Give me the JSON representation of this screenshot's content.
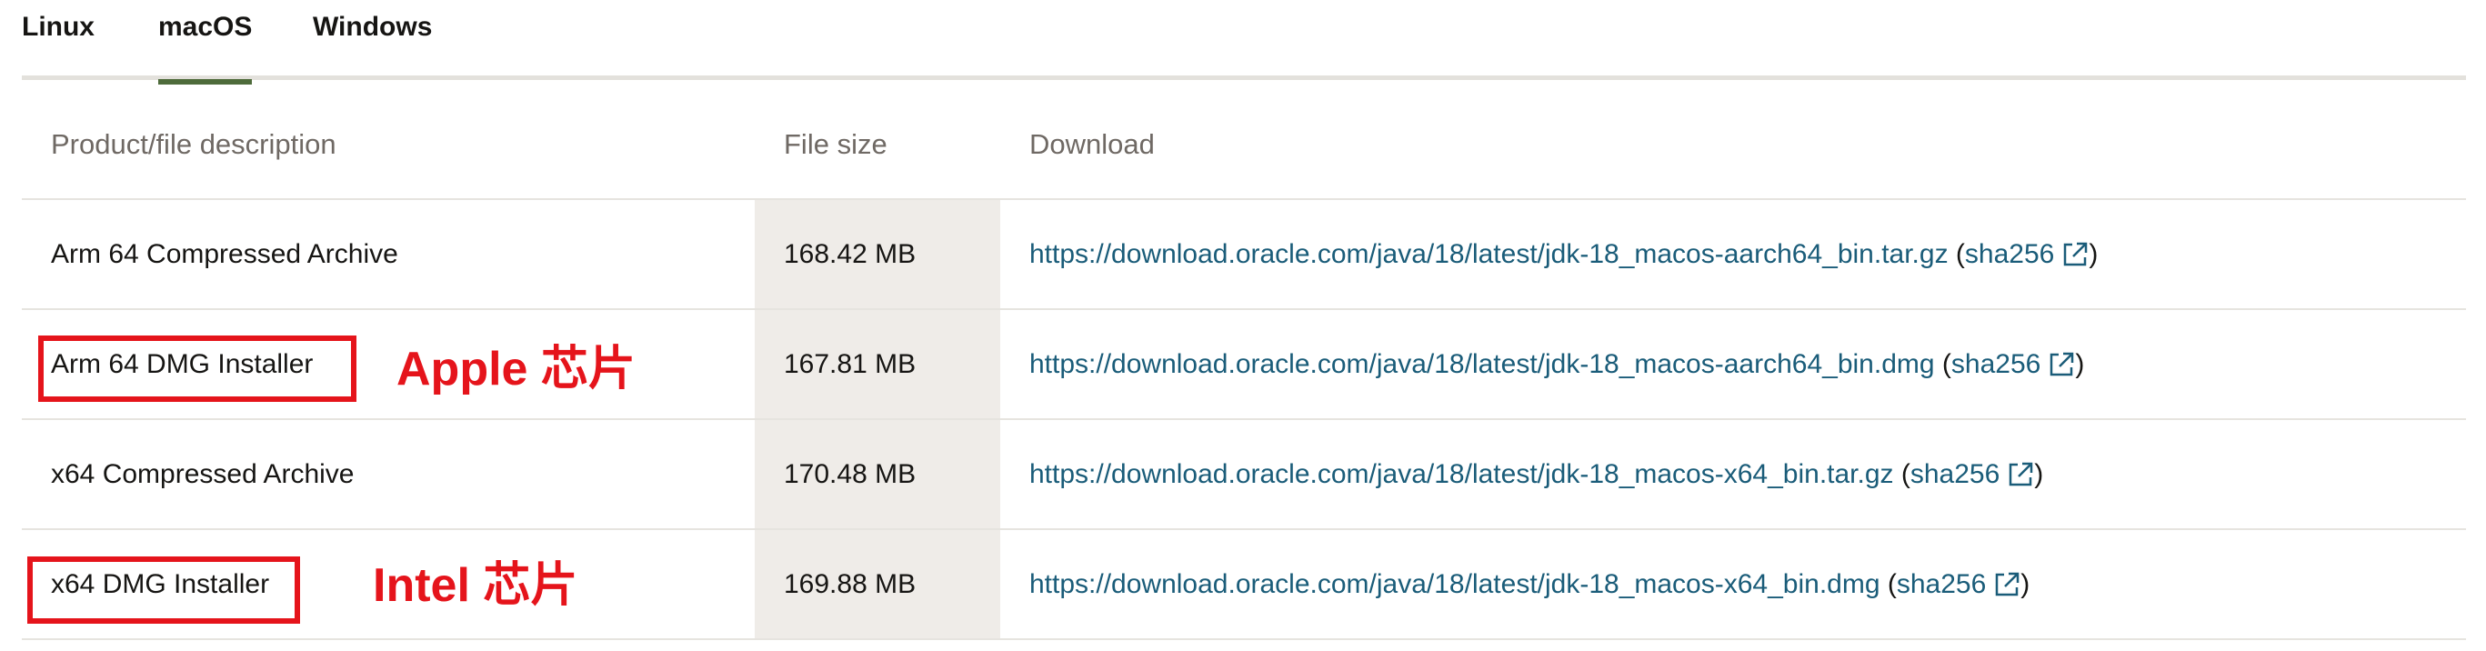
{
  "tabs": [
    {
      "label": "Linux",
      "active": false
    },
    {
      "label": "macOS",
      "active": true
    },
    {
      "label": "Windows",
      "active": false
    }
  ],
  "table": {
    "headers": {
      "description": "Product/file description",
      "size": "File size",
      "download": "Download"
    },
    "rows": [
      {
        "description": "Arm 64 Compressed Archive",
        "size": "168.42 MB",
        "url": "https://download.oracle.com/java/18/latest/jdk-18_macos-aarch64_bin.tar.gz",
        "checksum": "sha256"
      },
      {
        "description": "Arm 64 DMG Installer",
        "size": "167.81 MB",
        "url": "https://download.oracle.com/java/18/latest/jdk-18_macos-aarch64_bin.dmg",
        "checksum": "sha256"
      },
      {
        "description": "x64 Compressed Archive",
        "size": "170.48 MB",
        "url": "https://download.oracle.com/java/18/latest/jdk-18_macos-x64_bin.tar.gz",
        "checksum": "sha256"
      },
      {
        "description": "x64 DMG Installer",
        "size": "169.88 MB",
        "url": "https://download.oracle.com/java/18/latest/jdk-18_macos-x64_bin.dmg",
        "checksum": "sha256"
      }
    ]
  },
  "annotations": {
    "apple": "Apple 芯片",
    "intel": "Intel 芯片"
  },
  "colors": {
    "link": "#1a5c79",
    "active_tab_underline": "#4e6b3b",
    "annotation_red": "#e5141b",
    "size_column_bg": "#efece8"
  },
  "icons": {
    "external_link": "external-link-icon"
  }
}
